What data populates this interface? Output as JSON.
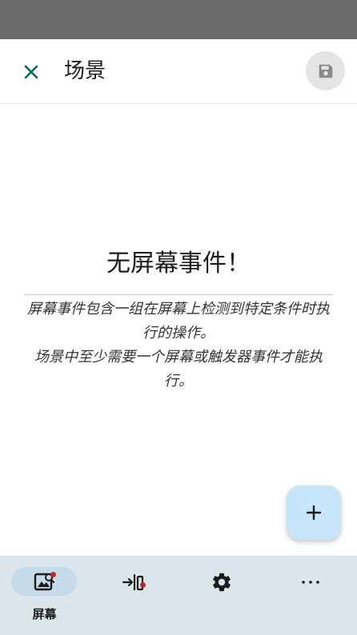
{
  "app_bar": {
    "title": "场景",
    "close_icon": "close-icon",
    "save_icon": "save-icon"
  },
  "empty_state": {
    "title": "无屏幕事件！",
    "line1": "屏幕事件包含一组在屏幕上检测到特定条件时执行的操作。",
    "line2": "场景中至少需要一个屏幕或触发器事件才能执行。"
  },
  "fab": {
    "icon": "plus-icon",
    "label": "+"
  },
  "bottom_nav": {
    "items": [
      {
        "icon": "image-search-icon",
        "label": "屏幕",
        "selected": true,
        "badge": true
      },
      {
        "icon": "trigger-input-icon",
        "label": "",
        "selected": false,
        "badge": true
      },
      {
        "icon": "gear-icon",
        "label": "",
        "selected": false,
        "badge": false
      },
      {
        "icon": "more-horizontal-icon",
        "label": "",
        "selected": false,
        "badge": false
      }
    ]
  },
  "colors": {
    "accent": "#00695c",
    "fab_background": "#c8e6fa",
    "nav_background": "#dae5ec",
    "badge": "#c62828",
    "status_bar": "#6b6b6b"
  }
}
